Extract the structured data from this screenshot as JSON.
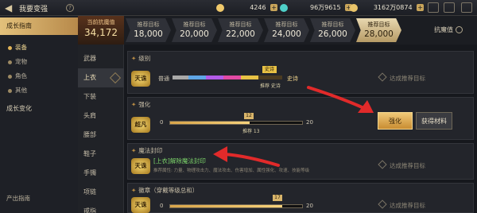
{
  "header": {
    "title": "我要变强",
    "currencies": [
      {
        "value": "4246",
        "color": "#f0c96b"
      },
      {
        "value": "96万9615",
        "color": "#4fd0c8"
      },
      {
        "value": "3162万0874",
        "color": "#e9c46a"
      }
    ]
  },
  "left_nav": {
    "sections": [
      {
        "label": "成长指南",
        "active": true
      },
      {
        "label": "成长变化",
        "active": false
      }
    ],
    "sub_items": [
      "装备",
      "宠物",
      "角色",
      "其他"
    ],
    "footer": "产出指南"
  },
  "slots": [
    "武器",
    "上衣",
    "下装",
    "头肩",
    "腰部",
    "鞋子",
    "手镯",
    "项链",
    "戒指"
  ],
  "targets": {
    "current_label": "当前抗魔值",
    "current_value": "34,172",
    "items": [
      {
        "label": "推荐目标",
        "value": "18,000"
      },
      {
        "label": "推荐目标",
        "value": "20,000"
      },
      {
        "label": "推荐目标",
        "value": "22,000"
      },
      {
        "label": "推荐目标",
        "value": "24,000"
      },
      {
        "label": "推荐目标",
        "value": "26,000"
      },
      {
        "label": "推荐目标",
        "value": "28,000"
      }
    ],
    "right_label": "抗魔值"
  },
  "panel_rarity": {
    "header": "级别",
    "badge": "天诛",
    "left_text": "普通",
    "right_text": "史诗",
    "marker_label": "史诗",
    "marker_sub": "推荐 史诗",
    "reach_text": "达成推荐目标"
  },
  "panel_enhance": {
    "header": "强化",
    "badge": "超凡",
    "min": "0",
    "max": "20",
    "current": "12",
    "recommend": "推荐 13",
    "progress": 0.6,
    "enhance_button": "强化",
    "get_button": "获得材料"
  },
  "panel_seal": {
    "header": "魔法封印",
    "badge": "天诛",
    "title": "[上衣]解除魔法封印",
    "detail": "推荐属性: 力量、物理攻击力、魔法攻击、伤害增加、属性强化、攻速、技能等级",
    "reach_text": "达成推荐目标"
  },
  "panel_tune": {
    "header": "徽章（穿戴等级总和）",
    "badge": "天诛",
    "min": "0",
    "max": "20",
    "current": "17",
    "progress": 0.85,
    "reach_text": "达成推荐目标"
  }
}
